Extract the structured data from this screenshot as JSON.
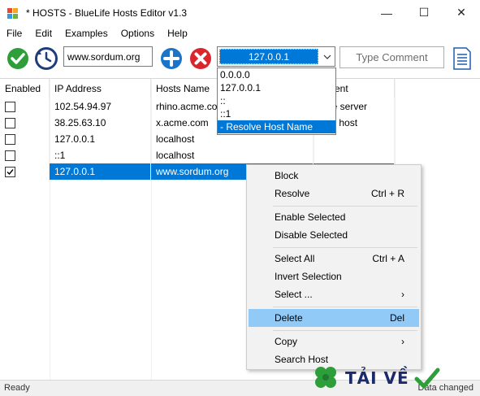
{
  "window": {
    "title": "* HOSTS - BlueLife Hosts Editor v1.3",
    "minimize": "—",
    "maximize": "☐",
    "close": "✕"
  },
  "menu": [
    "File",
    "Edit",
    "Examples",
    "Options",
    "Help"
  ],
  "toolbar": {
    "host_value": "www.sordum.org",
    "ip_value": "127.0.0.1",
    "type_comment_label": "Type Comment"
  },
  "ip_dropdown": {
    "options": [
      "0.0.0.0",
      "127.0.0.1",
      "::",
      "::1",
      "- Resolve Host Name"
    ],
    "highlighted_index": 4
  },
  "table": {
    "columns": [
      "Enabled",
      "IP Address",
      "Hosts Name",
      "mment"
    ],
    "rows": [
      {
        "checked": false,
        "ip": "102.54.94.97",
        "host": "rhino.acme.co",
        "comment": "urce server"
      },
      {
        "checked": false,
        "ip": "38.25.63.10",
        "host": "x.acme.com",
        "comment": "lient host"
      },
      {
        "checked": false,
        "ip": "127.0.0.1",
        "host": "localhost",
        "comment": ""
      },
      {
        "checked": false,
        "ip": "::1",
        "host": "localhost",
        "comment": ""
      },
      {
        "checked": true,
        "ip": "127.0.0.1",
        "host": "www.sordum.org",
        "comment": "",
        "selected": true
      }
    ]
  },
  "context_menu": {
    "items": [
      {
        "label": "Block",
        "shortcut": ""
      },
      {
        "label": "Resolve",
        "shortcut": "Ctrl + R"
      },
      {
        "label": "Enable Selected",
        "shortcut": ""
      },
      {
        "label": "Disable Selected",
        "shortcut": ""
      },
      {
        "label": "Select All",
        "shortcut": "Ctrl + A"
      },
      {
        "label": "Invert Selection",
        "shortcut": ""
      },
      {
        "label": "Select ...",
        "shortcut": "›"
      },
      {
        "label": "Delete",
        "shortcut": "Del"
      },
      {
        "label": "Copy",
        "shortcut": "›"
      },
      {
        "label": "Search Host",
        "shortcut": ""
      }
    ],
    "highlighted": "Delete"
  },
  "status": {
    "left": "Ready",
    "right": "Data changed"
  },
  "watermark": {
    "text": "TẢI VỀ"
  },
  "colors": {
    "accent": "#0078d7",
    "highlight": "#91c9f7",
    "save_green": "#2e9e3a",
    "delete_red": "#d9262c",
    "add_blue": "#1b74c9"
  }
}
